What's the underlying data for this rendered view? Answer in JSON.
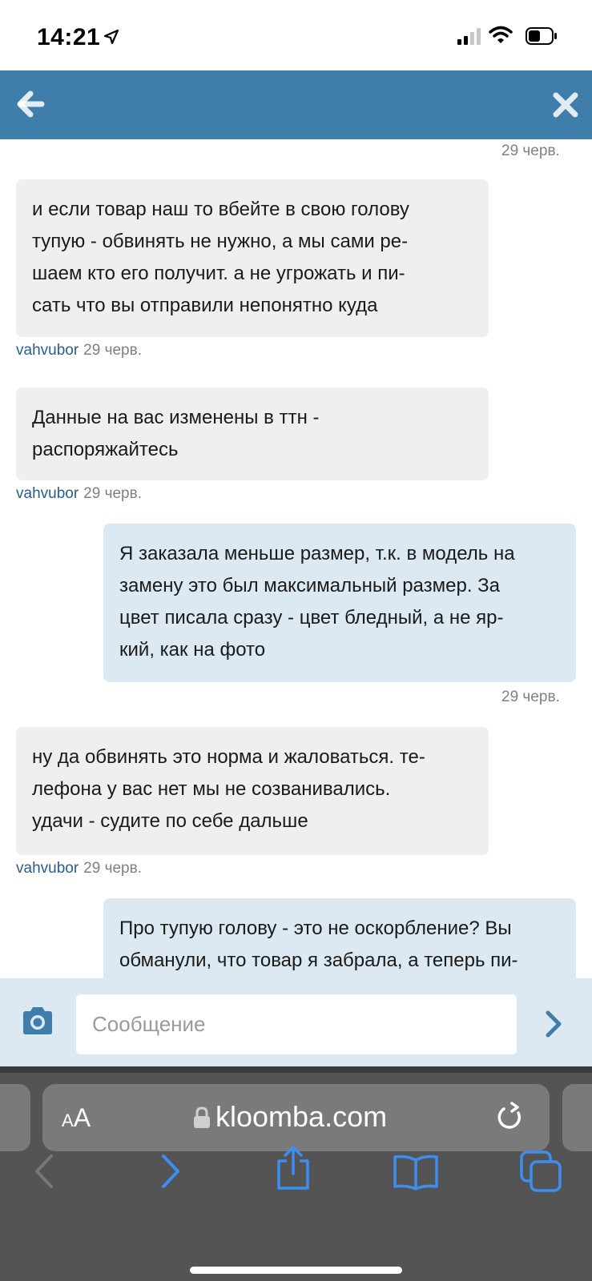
{
  "status_bar": {
    "time": "14:21",
    "icons": [
      "location-arrow-icon",
      "cellular-signal-icon",
      "wifi-icon",
      "battery-icon"
    ]
  },
  "header": {
    "back_icon": "arrow-left-icon",
    "close_icon": "close-icon",
    "color": "#3f7dab"
  },
  "messages": [
    {
      "direction": "out",
      "text": "",
      "time": "29 черв."
    },
    {
      "direction": "in",
      "author": "vahvubor",
      "time": "29 черв.",
      "lines": [
        "и если товар наш то вбейте в свою голову",
        "тупую - обвинять не нужно, а мы сами ре-",
        "шаем кто его получит. а не угрожать и пи-",
        "сать что вы отправили непонятно куда"
      ]
    },
    {
      "direction": "in",
      "author": "vahvubor",
      "time": "29 черв.",
      "lines": [
        "Данные на вас изменены в ттн -",
        "распоряжайтесь"
      ]
    },
    {
      "direction": "out",
      "time": "29 черв.",
      "lines": [
        "Я заказала меньше размер, т.к. в модель на",
        "замену это был максимальный размер. За",
        "цвет писала сразу - цвет бледный, а не яр-",
        "кий, как на фото"
      ]
    },
    {
      "direction": "in",
      "author": "vahvubor",
      "time": "29 черв.",
      "lines": [
        "ну да обвинять это норма и жаловаться. те-",
        "лефона у вас нет мы не созванивались.",
        "удачи - судите по себе дальше"
      ]
    },
    {
      "direction": "out",
      "lines": [
        "Про тупую голову - это не оскорбление? Вы",
        "обманули, что товар я забрала, а теперь пи-"
      ]
    }
  ],
  "composer": {
    "placeholder": "Сообщение",
    "camera_icon": "camera-icon",
    "send_icon": "chevron-right-icon"
  },
  "browser": {
    "aa_label_small": "A",
    "aa_label_large": "A",
    "url": "kloomba.com",
    "icons": [
      "lock-icon",
      "reload-icon",
      "back-icon",
      "forward-icon",
      "share-icon",
      "bookmarks-icon",
      "tabs-icon"
    ]
  },
  "colors": {
    "incoming_bubble": "#efefef",
    "outgoing_bubble": "#dce9f2",
    "author": "#2c5d8a",
    "safari_icon_blue": "#3d8ef0"
  }
}
